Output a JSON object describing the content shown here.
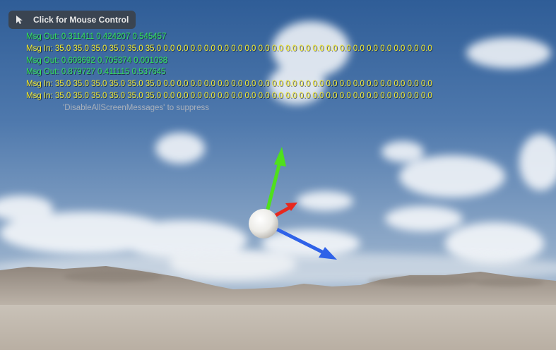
{
  "mouse_control": {
    "label": "Click for Mouse Control",
    "icon": "cursor-icon"
  },
  "messages": [
    {
      "kind": "out",
      "text": "Msg Out:  0.311411 0.424207 0.545457"
    },
    {
      "kind": "in",
      "text": "Msg In: 35.0 35.0 35.0 35.0 35.0 35.0 0.0 0.0 0.0 0.0 0.0 0.0 0.0 0.0 0.0 0.0 0.0 0.0 0.0 0.0 0.0 0.0 0.0 0.0 0.0 0.0"
    },
    {
      "kind": "out",
      "text": "Msg Out:  0.608692 0.705374 0.001038"
    },
    {
      "kind": "out",
      "text": "Msg Out:  0.879727 0.411115 0.537645"
    },
    {
      "kind": "in",
      "text": "Msg In: 35.0 35.0 35.0 35.0 35.0 35.0 0.0 0.0 0.0 0.0 0.0 0.0 0.0 0.0 0.0 0.0 0.0 0.0 0.0 0.0 0.0 0.0 0.0 0.0 0.0 0.0"
    },
    {
      "kind": "in",
      "text": "Msg In: 35.0 35.0 35.0 35.0 35.0 35.0 0.0 0.0 0.0 0.0 0.0 0.0 0.0 0.0 0.0 0.0 0.0 0.0 0.0 0.0 0.0 0.0 0.0 0.0 0.0 0.0"
    }
  ],
  "suppress_hint": "'DisableAllScreenMessages' to suppress",
  "colors": {
    "msg_out": "#34e05a",
    "msg_in": "#f0e830",
    "axis_x": "#e8281e",
    "axis_y": "#4fe01c",
    "axis_z": "#2f62e8",
    "sphere": "#f2f0ec"
  }
}
